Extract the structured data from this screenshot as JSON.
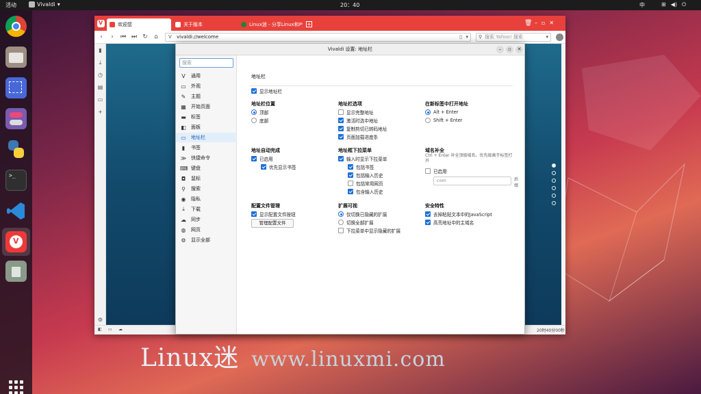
{
  "topbar": {
    "activities": "活动",
    "app_name": "Vivaldi",
    "clock": "20：40",
    "ime": "中"
  },
  "browser": {
    "tabs": [
      {
        "label": "欢迎您",
        "active": true
      },
      {
        "label": "关于版本",
        "active": false
      },
      {
        "label": "Linux迷 - 分享Linux和Pyth",
        "active": false
      }
    ],
    "url": "vivaldi://welcome",
    "search_placeholder": "搜索 Yahoo! 搜索",
    "status_time": "20时40分00秒"
  },
  "dialog": {
    "title": "Vivaldi 设置: 地址栏",
    "search_placeholder": "搜索",
    "nav": [
      {
        "icon": "V",
        "label": "通用"
      },
      {
        "icon": "▭",
        "label": "外观"
      },
      {
        "icon": "✎",
        "label": "主题"
      },
      {
        "icon": "▦",
        "label": "开始页面"
      },
      {
        "icon": "▬",
        "label": "标签"
      },
      {
        "icon": "◧",
        "label": "面板"
      },
      {
        "icon": "▭",
        "label": "地址栏",
        "selected": true
      },
      {
        "icon": "▮",
        "label": "书签"
      },
      {
        "icon": "≫",
        "label": "快捷命令"
      },
      {
        "icon": "⌨",
        "label": "键盘"
      },
      {
        "icon": "◘",
        "label": "鼠标"
      },
      {
        "icon": "⚲",
        "label": "搜索"
      },
      {
        "icon": "◉",
        "label": "隐私"
      },
      {
        "icon": "⤓",
        "label": "下载"
      },
      {
        "icon": "☁",
        "label": "同步"
      },
      {
        "icon": "◍",
        "label": "网页"
      },
      {
        "icon": "⚙",
        "label": "显示全部"
      }
    ],
    "section_title": "地址栏",
    "show_address_bar": {
      "label": "显示地址栏",
      "checked": true
    },
    "groups": {
      "position": {
        "title": "地址栏位置",
        "options": [
          {
            "label": "顶部",
            "selected": true
          },
          {
            "label": "底部",
            "selected": false
          }
        ]
      },
      "options": {
        "title": "地址栏选项",
        "items": [
          {
            "label": "显示完整地址",
            "checked": false
          },
          {
            "label": "激活时选中地址",
            "checked": true
          },
          {
            "label": "复制剪切已转码地址",
            "checked": true
          },
          {
            "label": "页面加载进度条",
            "checked": true
          }
        ]
      },
      "newtab": {
        "title": "在新标签中打开地址",
        "options": [
          {
            "label": "Alt + Enter",
            "selected": true
          },
          {
            "label": "Shift + Enter",
            "selected": false
          }
        ]
      },
      "autocomplete": {
        "title": "地址自动完成",
        "items": [
          {
            "label": "已启用",
            "checked": true
          },
          {
            "label": "优先显示书签",
            "checked": true
          }
        ]
      },
      "dropdown": {
        "title": "地址框下拉菜单",
        "items": [
          {
            "label": "输入时显示下拉菜单",
            "checked": true
          },
          {
            "label": "包括书签",
            "checked": true
          },
          {
            "label": "包括输入历史",
            "checked": true
          },
          {
            "label": "包括常用网页",
            "checked": false
          },
          {
            "label": "包含输入历史",
            "checked": true
          }
        ]
      },
      "domain": {
        "title": "域名补全",
        "note": "Ctrl + Enter 补全顶级域名。优先级高于标签打开",
        "enabled": {
          "label": "已启用",
          "checked": false
        },
        "value": "com",
        "suffix": "后缀"
      },
      "profile": {
        "title": "配置文件管理",
        "item": {
          "label": "显示配置文件按钮",
          "checked": true
        },
        "button": "管理配置文件"
      },
      "extensions": {
        "title": "扩展可视",
        "options": [
          {
            "label": "仅切换已隐藏的扩展",
            "selected": true
          },
          {
            "label": "切换全部扩展",
            "selected": false
          }
        ],
        "item": {
          "label": "下拉菜单中显示隐藏的扩展",
          "checked": false
        }
      },
      "security": {
        "title": "安全特性",
        "items": [
          {
            "label": "去掉粘贴文本中的JavaScript",
            "checked": true
          },
          {
            "label": "高亮地址中的主域名",
            "checked": true
          }
        ]
      }
    }
  },
  "watermark": {
    "brand": "Linux迷",
    "url": "www.linuxmi.com"
  }
}
